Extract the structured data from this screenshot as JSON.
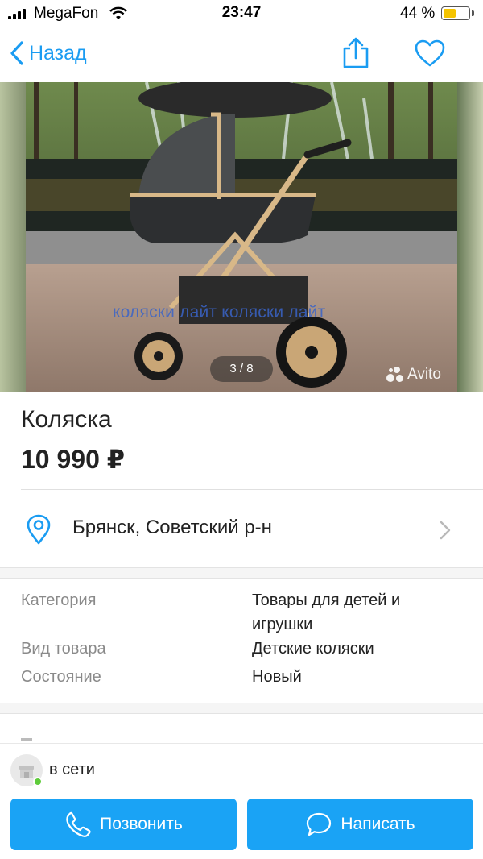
{
  "status_bar": {
    "carrier": "MegaFon",
    "time": "23:47",
    "battery_percent": "44 %",
    "battery_level": 0.44
  },
  "nav": {
    "back_label": "Назад",
    "icons": [
      "chevron-left-icon",
      "share-icon",
      "heart-icon"
    ]
  },
  "photo": {
    "pager": "3 / 8",
    "watermark": "коляски лайт  коляски лайт",
    "brand": "Avito"
  },
  "listing": {
    "title": "Коляска",
    "price": "10 990 ₽",
    "location": "Брянск, Советский р-н"
  },
  "params": [
    {
      "label": "Категория",
      "value": "Товары для детей и игрушки"
    },
    {
      "label": "Вид товара",
      "value": "Детские коляски"
    },
    {
      "label": "Состояние",
      "value": "Новый"
    }
  ],
  "seller": {
    "status": "в сети"
  },
  "actions": {
    "call_label": "Позвонить",
    "write_label": "Написать"
  },
  "colors": {
    "accent": "#1aa3f5",
    "link": "#1a9cf2",
    "online": "#5ecb3a"
  }
}
